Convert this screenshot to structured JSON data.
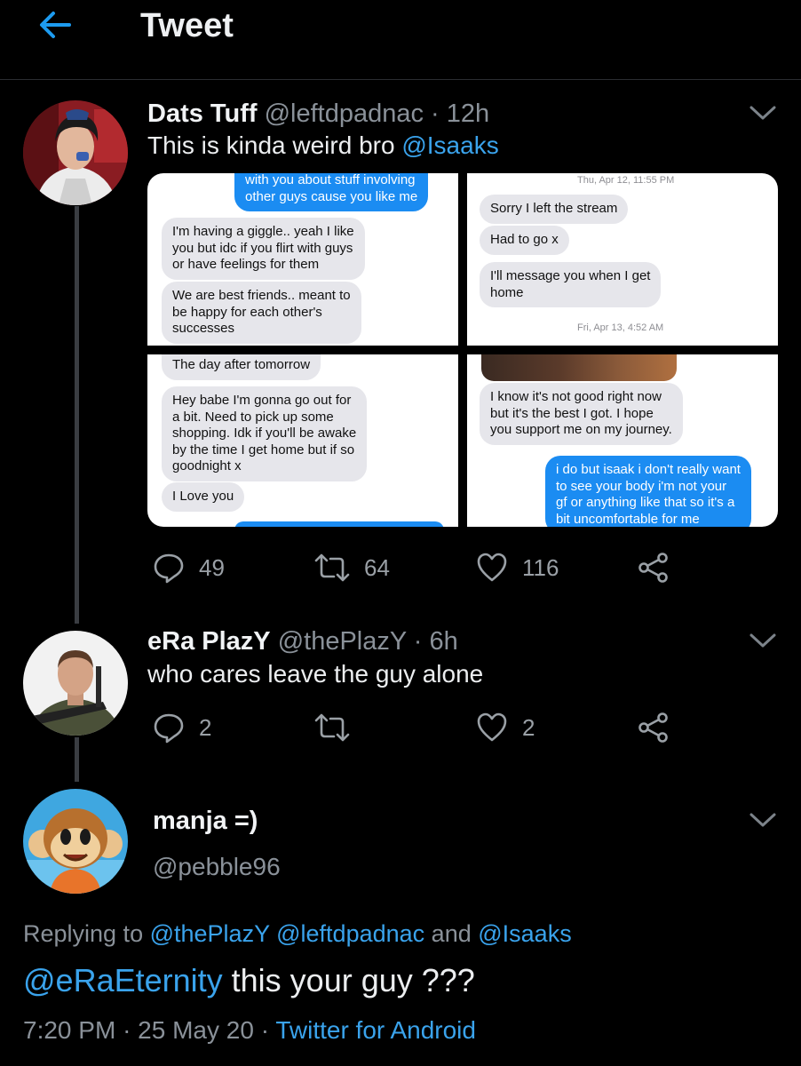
{
  "header": {
    "title": "Tweet",
    "back_icon": "arrow-left-icon",
    "accent": "#1d9bf0"
  },
  "tweet1": {
    "name": "Dats Tuff",
    "handle": "@leftdpadnac",
    "sep": "·",
    "time": "12h",
    "text": "This is kinda weird bro",
    "mention": "@Isaaks",
    "media": {
      "p1": {
        "b_top": "with you about stuff involving\nother guys cause you like me",
        "b1": "I'm having a giggle.. yeah I like\nyou but idc if you flirt with guys\nor have feelings for them",
        "b2": "We are best friends.. meant to\nbe happy for each other's\nsuccesses"
      },
      "p2": {
        "stamp1": "Thu, Apr 12, 11:55 PM",
        "b1": "Sorry I left the stream",
        "b2": "Had to go x",
        "b3": "I'll message you when I get\nhome",
        "stamp2": "Fri, Apr 13, 4:52 AM"
      },
      "p3": {
        "b1": "The day after tomorrow",
        "b2": "Hey babe I'm gonna go out for\na bit. Need to pick up some\nshopping. Idk if you'll be awake\nby the time I get home but if so\ngoodnight x",
        "b3": "I Love you"
      },
      "p4": {
        "b1": "I know it's not good right now\nbut it's the best I got. I hope\nyou support me on my journey.",
        "b2": "i do but isaak i don't really want\nto see your body i'm not your\ngf or anything like that so it's a\nbit uncomfortable for me"
      }
    },
    "actions": {
      "replies": "49",
      "retweets": "64",
      "likes": "116"
    }
  },
  "tweet2": {
    "name": "eRa PlazY",
    "handle": "@thePlazY",
    "sep": "·",
    "time": "6h",
    "text": "who cares leave the guy alone",
    "actions": {
      "replies": "2",
      "retweets": "",
      "likes": "2"
    }
  },
  "main_tweet": {
    "name": "manja =)",
    "handle": "@pebble96",
    "replying_label": "Replying to",
    "replying_to_1": "@thePlazY",
    "replying_to_2": "@leftdpadnac",
    "replying_and": "and",
    "replying_to_3": "@Isaaks",
    "mention": "@eRaEternity",
    "text": "this your guy ???",
    "time": "7:20 PM",
    "sep": "·",
    "date": "25 May 20",
    "source": "Twitter for Android"
  }
}
